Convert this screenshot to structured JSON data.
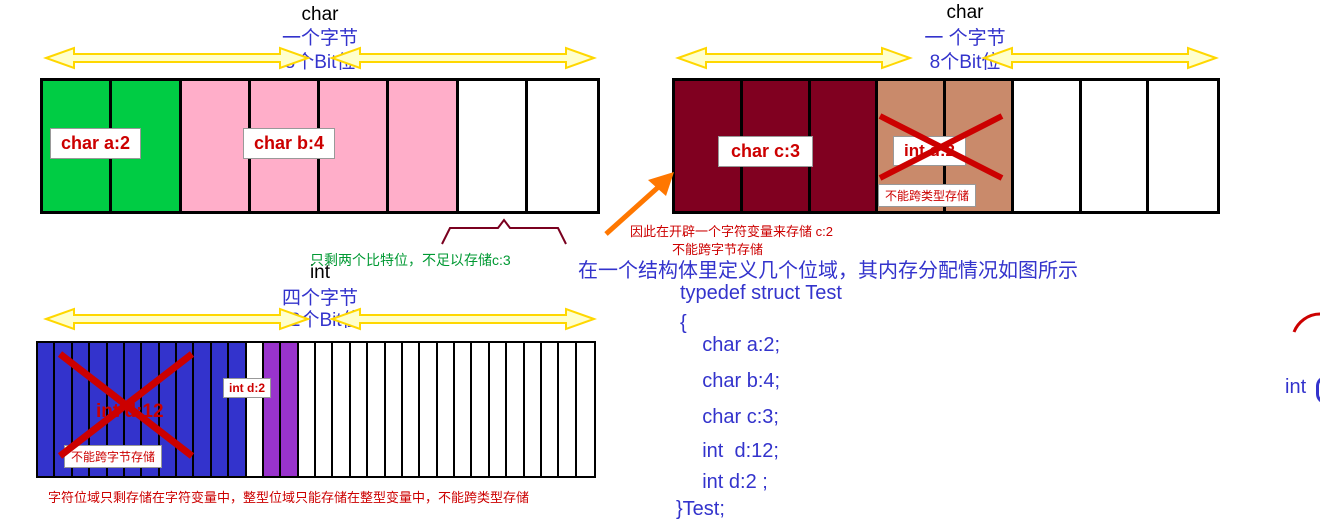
{
  "diagram": {
    "char1": {
      "title": "char",
      "sub_line1": "一个字节",
      "sub_line2": "8个Bit位",
      "field_a": "char  a:2",
      "field_b": "char  b:4",
      "color_a": "#00cc44",
      "color_b": "#ffaec9"
    },
    "char2": {
      "title": "char",
      "sub_line1": "一 个字节",
      "sub_line2": "8个Bit位",
      "field_c": "char c:3",
      "field_d": "int d:2",
      "field_d_note": "不能跨类型存储",
      "color_c": "#800020",
      "color_d": "#c98a6b"
    },
    "int1": {
      "title": "int",
      "sub_line1": "四个字节",
      "sub_line2": "32个Bit位",
      "field_d12": "int d:12",
      "field_d12_note": "不能跨字节存储",
      "field_d2": "int d:2",
      "color_d12": "#3333cc",
      "color_d2": "#9933cc"
    },
    "annotations": {
      "green_note": "只剩两个比特位，不足以存储c:3",
      "red_note_line1": "因此在开辟一个字符变量来存储 c:2",
      "red_note_line2": "不能跨字节存储",
      "bottom_note": "字符位域只剩存储在字符变量中，整型位域只能存储在整型变量中，不能跨类型存储"
    }
  },
  "code_panel": {
    "heading": "在一个结构体里定义几个位域，其内存分配情况如图所示",
    "lines": [
      "typedef struct Test",
      "{",
      "    char a:2;",
      "    char b:4;",
      "    char c:3;",
      "    int  d:12;",
      "    int d:2 ;",
      "}Test;"
    ]
  },
  "right_edge": {
    "fragment": "int"
  },
  "colors": {
    "arrow_yellow": "#ffd700",
    "blue_text": "#3333cc",
    "red_text": "#cc0000",
    "green_text": "#009933",
    "orange_arrow": "#ff7700"
  }
}
